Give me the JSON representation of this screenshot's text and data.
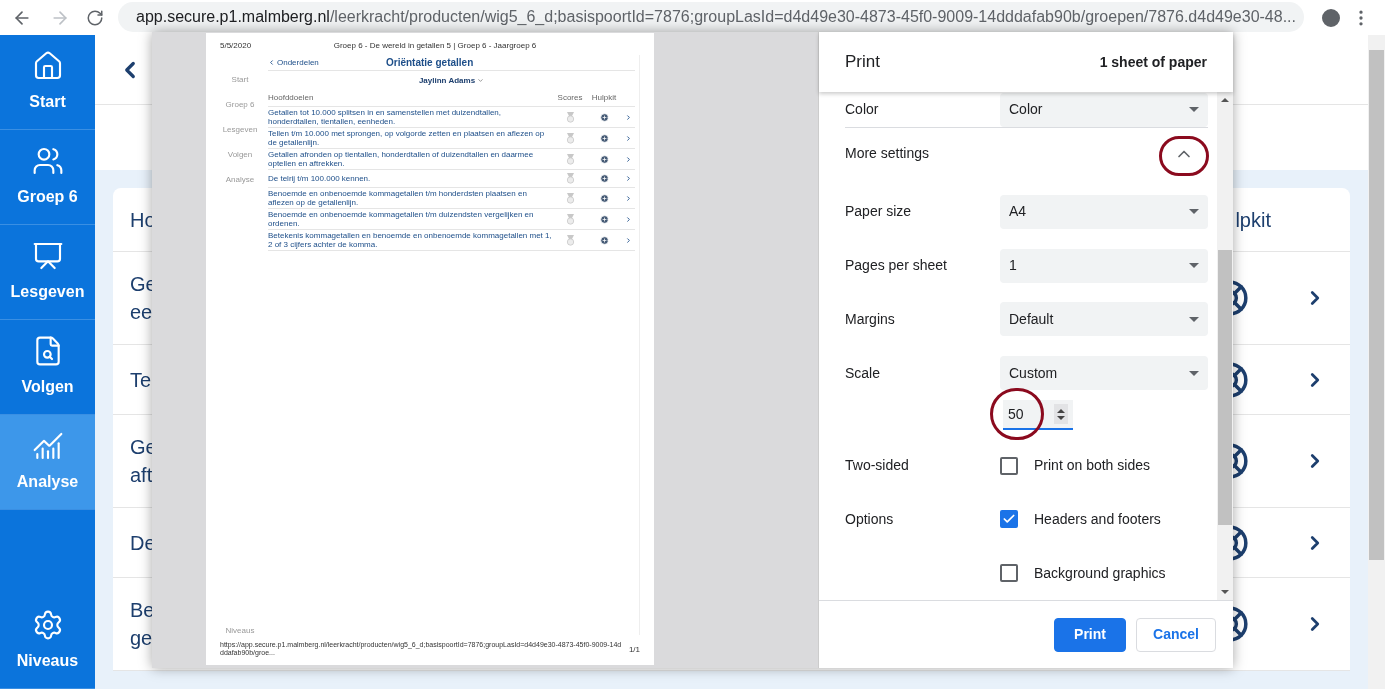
{
  "browser": {
    "url_host": "app.secure.p1.malmberg.nl",
    "url_path": "/leerkracht/producten/wig5_6_d;basispoortId=7876;groupLasId=d4d49e30-4873-45f0-9009-14dddafab90b/groepen/7876.d4d49e30-48..."
  },
  "sidebar": {
    "items": [
      {
        "kind": "home",
        "label": "Start",
        "selected": false
      },
      {
        "kind": "group",
        "label": "Groep 6",
        "selected": false
      },
      {
        "kind": "teach",
        "label": "Lesgeven",
        "selected": false
      },
      {
        "kind": "follow",
        "label": "Volgen",
        "selected": false
      },
      {
        "kind": "chart",
        "label": "Analyse",
        "selected": true
      }
    ],
    "footer_item": {
      "kind": "settings",
      "label": "Niveaus",
      "selected": false
    }
  },
  "page": {
    "table_heading": "Ho",
    "right_heading": "lpkit",
    "rows": [
      {
        "lines": [
          "Ge",
          "ee"
        ]
      },
      {
        "lines": [
          "Te"
        ]
      },
      {
        "lines": [
          "Ge",
          "aft"
        ]
      },
      {
        "lines": [
          "De"
        ]
      },
      {
        "lines": [
          "Be",
          "ge"
        ]
      }
    ]
  },
  "print_dialog": {
    "title": "Print",
    "sheets": "1 sheet of paper",
    "settings": [
      {
        "kind": "select",
        "label": "Color",
        "value": "Color"
      },
      {
        "kind": "toggle",
        "label": "More settings",
        "expanded": true,
        "highlighted": true
      },
      {
        "kind": "select",
        "label": "Paper size",
        "value": "A4"
      },
      {
        "kind": "select",
        "label": "Pages per sheet",
        "value": "1"
      },
      {
        "kind": "select",
        "label": "Margins",
        "value": "Default"
      },
      {
        "kind": "select",
        "label": "Scale",
        "value": "Custom"
      },
      {
        "kind": "number",
        "value": "50",
        "highlighted": true
      },
      {
        "kind": "checkbox",
        "label": "Two-sided",
        "text": "Print on both sides",
        "checked": false
      },
      {
        "kind": "checkbox",
        "label": "Options",
        "text": "Headers and footers",
        "checked": true
      },
      {
        "kind": "checkbox",
        "text": "Background graphics",
        "checked": false
      }
    ],
    "buttons": [
      {
        "label": "Print",
        "primary": true
      },
      {
        "label": "Cancel",
        "primary": false
      }
    ]
  },
  "preview": {
    "date": "5/5/2020",
    "header": "Groep 6 - De wereld in getallen 5 | Groep 6 - Jaargroep 6",
    "nav": [
      "Start",
      "Groep 6",
      "Lesgeven",
      "Volgen",
      "Analyse"
    ],
    "nav_footer": "Niveaus",
    "back": "Onderdelen",
    "title": "Oriëntatie getallen",
    "student": "Jaylinn Adams",
    "columns": [
      "Hoofddoelen",
      "Scores",
      "Hulpkit"
    ],
    "rows": [
      "Getallen tot 10.000 splitsen in en samenstellen met duizendtallen, honderdtallen, tientallen, eenheden.",
      "Tellen t/m 10.000 met sprongen, op volgorde zetten en plaatsen en aflezen op de getallenlijn.",
      "Getallen afronden op tientallen, honderdtallen of duizendtallen en daarmee optellen en aftrekken.",
      "De telrij t/m 100.000 kennen.",
      "Benoemde en onbenoemde kommagetallen t/m honderdsten plaatsen en aflezen op de getallenlijn.",
      "Benoemde en onbenoemde kommagetallen t/m duizendsten vergelijken en ordenen.",
      "Betekenis kommagetallen en benoemde en onbenoemde kommagetallen met 1, 2 of 3 cijfers achter de komma."
    ],
    "footer_url": "https://app.secure.p1.malmberg.nl/leerkracht/producten/wig5_6_d;basispoortId=7876;groupLasId=d4d49e30-4873-45f0-9009-14dddafab90b/groe...",
    "page": "1/1"
  }
}
